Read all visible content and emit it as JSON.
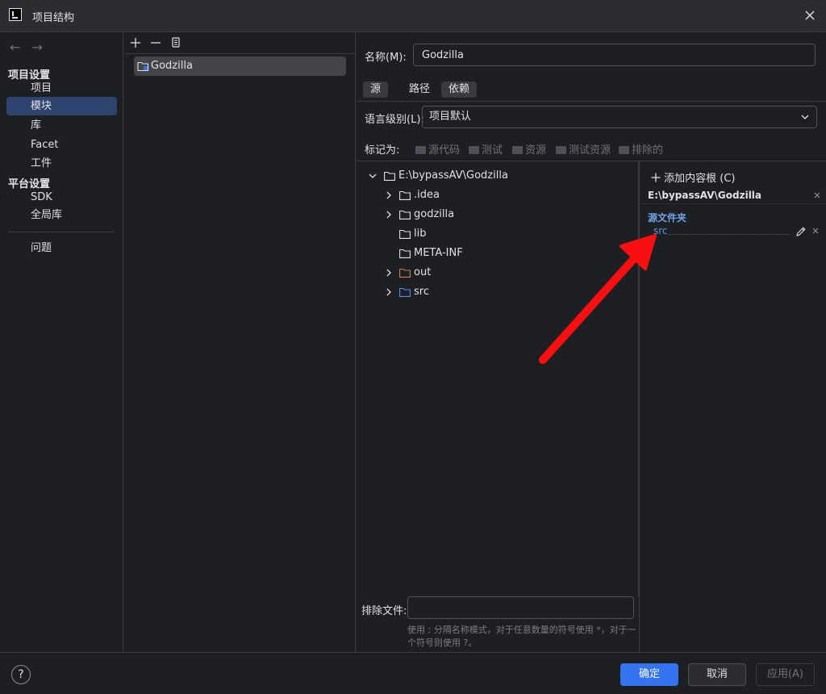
{
  "window": {
    "title": "项目结构",
    "accent": "#3574f0"
  },
  "nav": {
    "back": "←",
    "forward": "→",
    "project_settings": "项目设置",
    "items_project": [
      "项目",
      "模块",
      "库",
      "Facet",
      "工件"
    ],
    "platform_settings": "平台设置",
    "items_platform": [
      "SDK",
      "全局库"
    ],
    "problems": "问题",
    "selected": "模块"
  },
  "modules": {
    "toolbar": {
      "add": "+",
      "remove": "—",
      "copy": "copy"
    },
    "items": [
      "Godzilla"
    ]
  },
  "detail": {
    "name_label": "名称(M):",
    "name_value": "Godzilla",
    "tabs": [
      "源",
      "路径",
      "依赖"
    ],
    "active_tab": "源",
    "lang_label": "语言级别(L):",
    "lang_value": "项目默认",
    "mark_label": "标记为:",
    "mark_as": [
      "源代码",
      "测试",
      "资源",
      "测试资源",
      "排除的"
    ],
    "tree": {
      "root": "E:\\bypassAV\\Godzilla",
      "children": [
        ".idea",
        "godzilla",
        "lib",
        "META-INF",
        "out",
        "src"
      ]
    },
    "exclude_label": "排除文件:",
    "exclude_value": "",
    "hint": "使用 ; 分隔名称模式，对于任意数量的符号使用 *，对于一个符号则使用 ?。",
    "roots": {
      "add_root": "添加内容根 (C)",
      "path": "E:\\bypassAV\\Godzilla",
      "source_folders_label": "源文件夹",
      "source_folders": [
        "src"
      ]
    }
  },
  "footer": {
    "help": "?",
    "ok": "确定",
    "cancel": "取消",
    "apply": "应用(A)"
  }
}
